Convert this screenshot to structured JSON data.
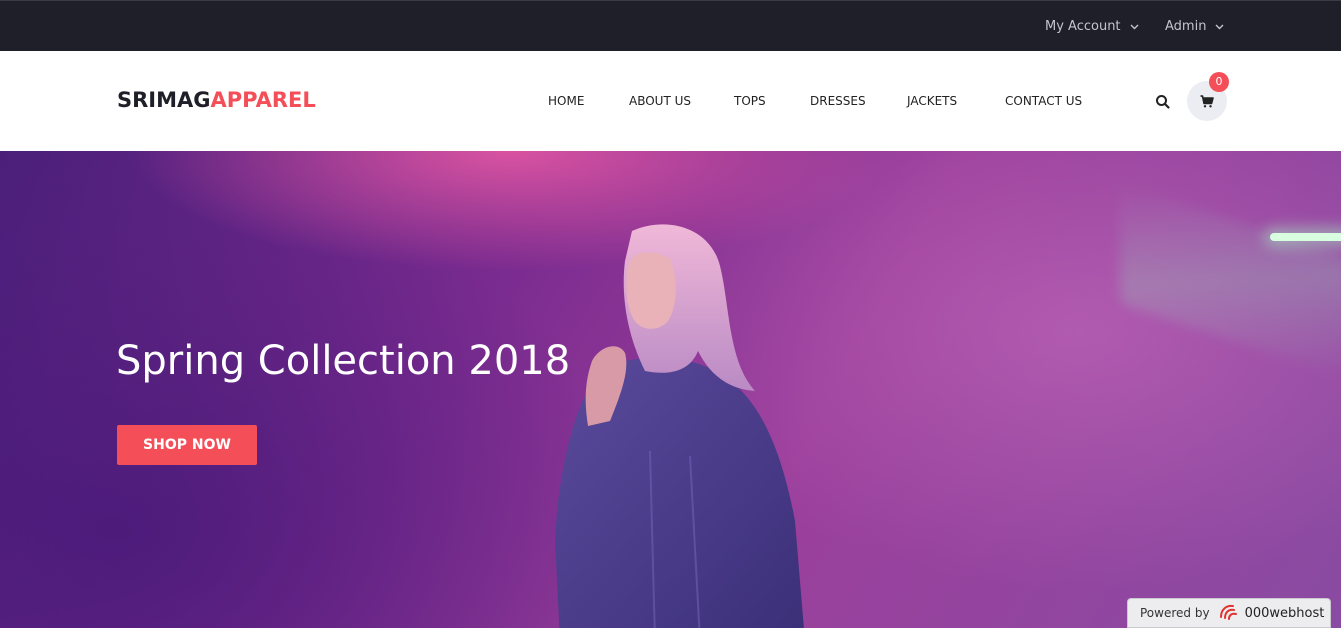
{
  "topbar": {
    "account_label": "My Account",
    "admin_label": "Admin"
  },
  "header": {
    "logo_part1": "SRIMAG",
    "logo_part2": "APPAREL",
    "nav": [
      "HOME",
      "ABOUT US",
      "TOPS",
      "DRESSES",
      "JACKETS",
      "CONTACT US"
    ],
    "cart_count": "0"
  },
  "hero": {
    "title": "Spring Collection 2018",
    "button_label": "SHOP NOW"
  },
  "badge": {
    "powered_label": "Powered by",
    "brand_name": "000webhost"
  },
  "colors": {
    "accent": "#f44f59",
    "topbar_bg": "#1f1f29"
  },
  "icons": [
    "chevron-down-icon",
    "search-icon",
    "cart-icon",
    "webhost-logo-icon"
  ]
}
